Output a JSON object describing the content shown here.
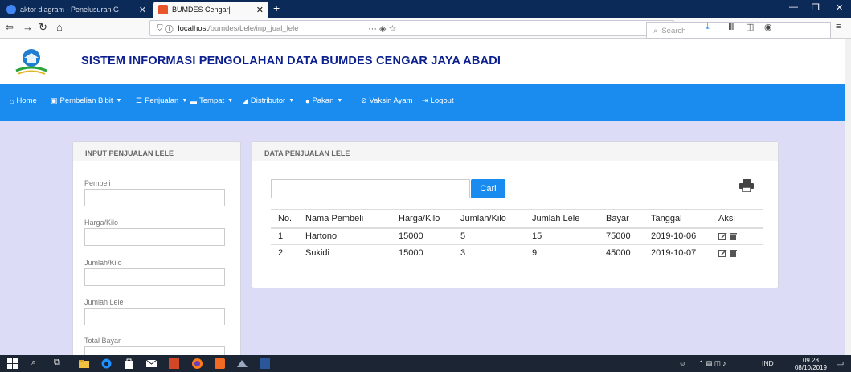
{
  "browser": {
    "tabs": [
      {
        "title": "aktor diagram - Penelusuran G",
        "icon": "google-icon",
        "active": false
      },
      {
        "title": "BUMDES Cengar|",
        "icon": "bumdes-favicon",
        "active": true
      }
    ],
    "url_host": "localhost",
    "url_path": "/bumdes/Lele/inp_jual_lele",
    "search_placeholder": "Search"
  },
  "header": {
    "title": "SISTEM INFORMASI PENGOLAHAN DATA BUMDES CENGAR JAYA ABADI"
  },
  "menu": [
    {
      "label": "Home",
      "icon": "home-icon",
      "dropdown": false
    },
    {
      "label": "Pembelian Bibit",
      "icon": "gift-icon",
      "dropdown": true
    },
    {
      "label": "Penjualan",
      "icon": "list-icon",
      "dropdown": true
    },
    {
      "label": "Tempat",
      "icon": "monitor-icon",
      "dropdown": true
    },
    {
      "label": "Distributor",
      "icon": "truck-icon",
      "dropdown": true
    },
    {
      "label": "Pakan",
      "icon": "info-icon",
      "dropdown": true
    },
    {
      "label": "Vaksin Ayam",
      "icon": "ban-icon",
      "dropdown": false
    },
    {
      "label": "Logout",
      "icon": "logout-icon",
      "dropdown": false
    }
  ],
  "input_panel": {
    "heading": "INPUT PENJUALAN LELE",
    "fields": [
      {
        "label": "Pembeli",
        "value": ""
      },
      {
        "label": "Harga/Kilo",
        "value": ""
      },
      {
        "label": "Jumlah/Kilo",
        "value": ""
      },
      {
        "label": "Jumlah Lele",
        "value": ""
      },
      {
        "label": "Total Bayar",
        "value": ""
      }
    ]
  },
  "data_panel": {
    "heading": "DATA PENJUALAN LELE",
    "search_value": "",
    "search_button": "Cari",
    "columns": [
      "No.",
      "Nama Pembeli",
      "Harga/Kilo",
      "Jumlah/Kilo",
      "Jumlah Lele",
      "Bayar",
      "Tanggal",
      "Aksi"
    ],
    "rows": [
      [
        "1",
        "Hartono",
        "15000",
        "5",
        "15",
        "75000",
        "2019-10-06"
      ],
      [
        "2",
        "Sukidi",
        "15000",
        "3",
        "9",
        "45000",
        "2019-10-07"
      ]
    ]
  },
  "taskbar": {
    "tray_lang": "IND",
    "time": "09.28",
    "date": "08/10/2019"
  },
  "colors": {
    "menu_bg": "#1a8cf0",
    "title_color": "#0c1f8f",
    "page_bg": "#dcdcf6"
  }
}
